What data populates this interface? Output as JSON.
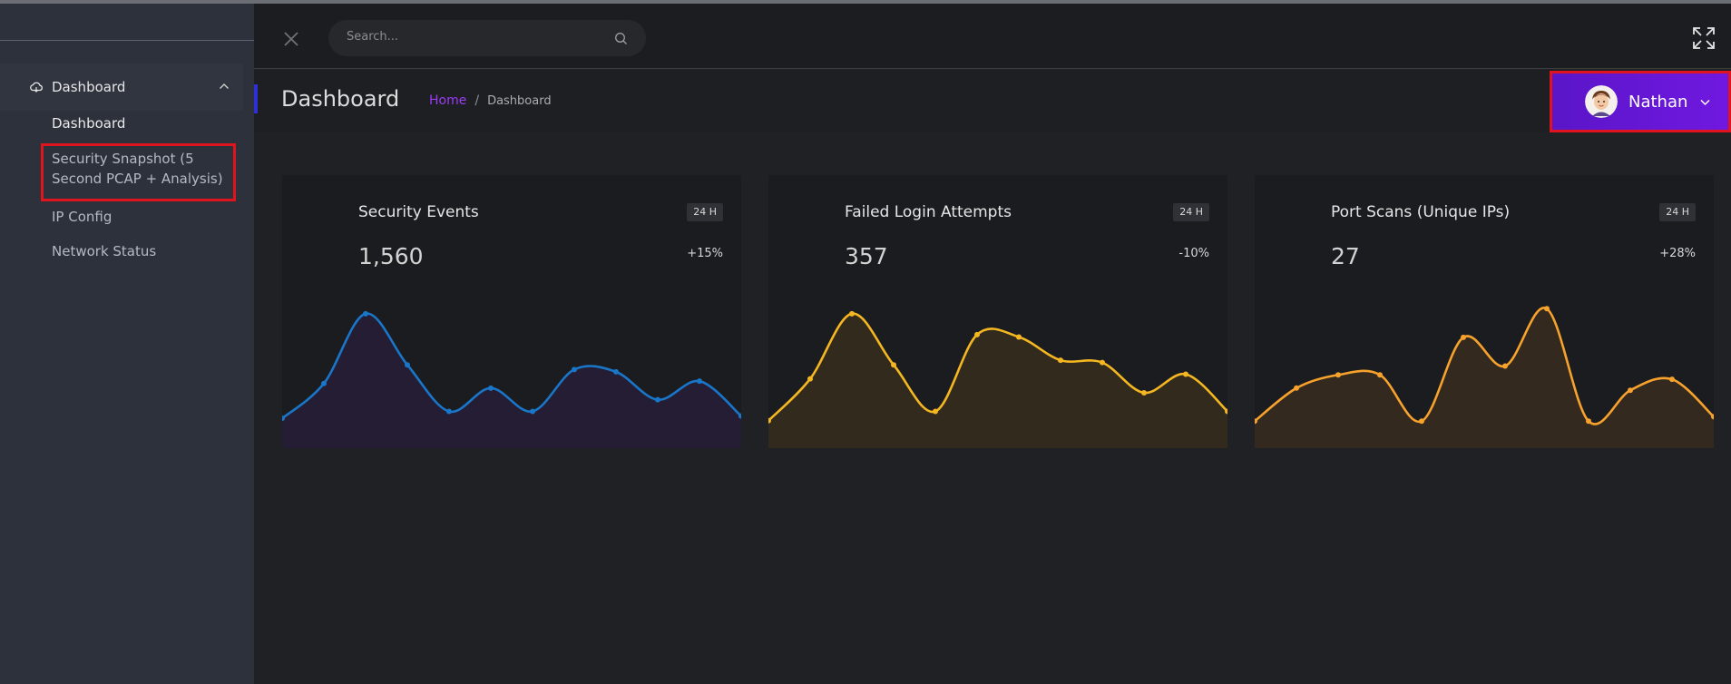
{
  "sidebar": {
    "group": {
      "label": "Dashboard",
      "icon": "cloud-icon"
    },
    "items": [
      {
        "label": "Dashboard"
      },
      {
        "label_line1": "Security Snapshot (5",
        "label_line2": "Second PCAP + Analysis)"
      },
      {
        "label": "IP Config"
      },
      {
        "label": "Network Status"
      }
    ]
  },
  "header": {
    "search_placeholder": "Search...",
    "close_icon": "close-icon",
    "expand_icon": "fullscreen-icon"
  },
  "page": {
    "title": "Dashboard",
    "breadcrumb": {
      "home": "Home",
      "separator": "/",
      "current": "Dashboard"
    }
  },
  "user": {
    "name": "Nathan"
  },
  "cards": [
    {
      "title": "Security Events",
      "badge": "24 H",
      "value": "1,560",
      "change": "+15%",
      "line_color": "#1976c8",
      "fill_color": "#241d34"
    },
    {
      "title": "Failed Login Attempts",
      "badge": "24 H",
      "value": "357",
      "change": "-10%",
      "line_color": "#f4b721",
      "fill_color": "#332a1e"
    },
    {
      "title": "Port Scans (Unique IPs)",
      "badge": "24 H",
      "value": "27",
      "change": "+28%",
      "line_color": "#f7a22c",
      "fill_color": "#33291f"
    }
  ],
  "chart_data": [
    {
      "type": "area",
      "series": [
        {
          "values": [
            35,
            50,
            80,
            58,
            38,
            48,
            38,
            56,
            55,
            43,
            51,
            36
          ]
        }
      ],
      "ylim": [
        30,
        85
      ]
    },
    {
      "type": "area",
      "series": [
        {
          "values": [
            34,
            52,
            80,
            58,
            38,
            71,
            70,
            60,
            59,
            46,
            54,
            38
          ]
        }
      ],
      "ylim": [
        30,
        85
      ]
    },
    {
      "type": "area",
      "series": [
        {
          "values": [
            34,
            49,
            55,
            55,
            34,
            72,
            59,
            85,
            34,
            48,
            53,
            36
          ]
        }
      ],
      "ylim": [
        30,
        88
      ]
    }
  ],
  "colors": {
    "accent_purple": "#7018e0",
    "link_purple": "#9b3cf5",
    "highlight_red": "#e0141e"
  }
}
